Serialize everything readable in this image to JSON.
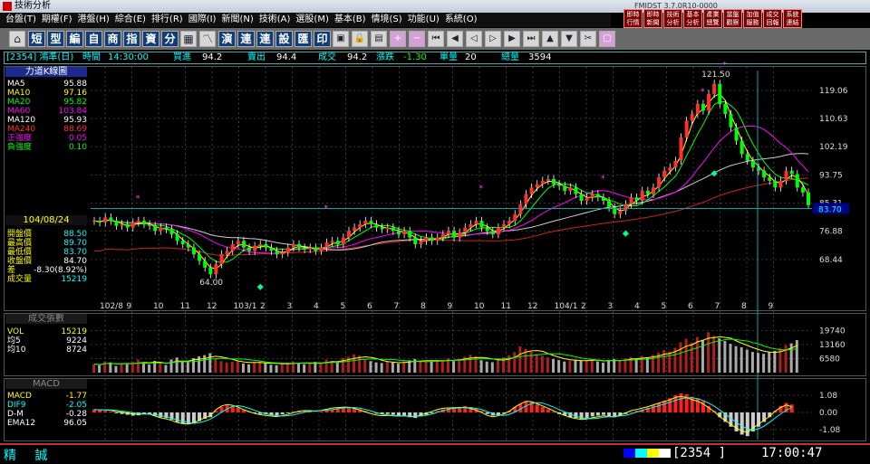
{
  "window": {
    "title": "技術分析",
    "version": "FMIDST 3.7.0R10-0000"
  },
  "menu": [
    "台盤(T)",
    "期權(F)",
    "港盤(H)",
    "綜合(E)",
    "排行(R)",
    "國際(I)",
    "新聞(N)",
    "技術(A)",
    "選股(M)",
    "基本(B)",
    "情境(S)",
    "功能(U)",
    "系統(O)"
  ],
  "right_buttons": [
    "即時行情",
    "即時新聞",
    "技術分析",
    "基本分析",
    "產業總覽",
    "當盤觀察",
    "加值服務",
    "成交回報",
    "系統連結"
  ],
  "toolbar": {
    "words": [
      "短",
      "型",
      "編",
      "自",
      "商",
      "指",
      "資",
      "分"
    ],
    "words2": [
      "演",
      "連",
      "連",
      "設",
      "匯",
      "印"
    ]
  },
  "infobar": {
    "code": "[2354] 鴻準(日)",
    "time_label": "時間",
    "time": "14:30:00",
    "buy_label": "買進",
    "buy": "94.2",
    "sell_label": "賣出",
    "sell": "94.4",
    "deal_label": "成交",
    "deal": "94.2",
    "change_label": "漲跌",
    "change": "-1.30",
    "unit_label": "單量",
    "unit": "20",
    "total_label": "總量",
    "total": "3594"
  },
  "price_panel": {
    "header": "力道K線圖",
    "indicators": [
      {
        "name": "MA5",
        "value": "95.88",
        "color": "#ffffff"
      },
      {
        "name": "MA10",
        "value": "97.16",
        "color": "#ffff00"
      },
      {
        "name": "MA20",
        "value": "95.82",
        "color": "#00ff00"
      },
      {
        "name": "MA60",
        "value": "103.84",
        "color": "#ff00ff"
      },
      {
        "name": "MA120",
        "value": "95.93",
        "color": "#ffffff"
      },
      {
        "name": "MA240",
        "value": "88.69",
        "color": "#ff3030"
      },
      {
        "name": "正強度",
        "value": "0.05",
        "color": "#ff00ff"
      },
      {
        "name": "負強度",
        "value": "0.10",
        "color": "#00ff00"
      }
    ],
    "date": "104/08/24",
    "ohlc": [
      {
        "name": "開盤價",
        "value": "88.50",
        "color": "#ffff00",
        "vcolor": "#00ffff"
      },
      {
        "name": "最高價",
        "value": "89.70",
        "color": "#ffff00",
        "vcolor": "#00ffff"
      },
      {
        "name": "最低價",
        "value": "83.70",
        "color": "#ffff00",
        "vcolor": "#00ffff"
      },
      {
        "name": "收盤價",
        "value": "84.70",
        "color": "#ffff00",
        "vcolor": "#ffffff"
      },
      {
        "name": "差",
        "value": "-8.30(8.92%)",
        "color": "#ffff00",
        "vcolor": "#ffffff"
      },
      {
        "name": "成交量",
        "value": "15219",
        "color": "#ffff00",
        "vcolor": "#00ffff"
      }
    ],
    "yticks": [
      "119.06",
      "110.63",
      "102.19",
      "93.75",
      "85.31",
      "76.88",
      "68.44"
    ],
    "cursor_price": "83.70",
    "high_label": "121.50",
    "low_label": "64.00",
    "xticks": [
      "102/8",
      "9",
      "10",
      "11",
      "12",
      "103/1",
      "2",
      "3",
      "4",
      "5",
      "6",
      "7",
      "8",
      "9",
      "10",
      "11",
      "12",
      "104/1",
      "2",
      "3",
      "4",
      "5",
      "6",
      "7",
      "8",
      "9"
    ]
  },
  "volume_panel": {
    "header": "成交張數",
    "indicators": [
      {
        "name": "VOL",
        "value": "15219",
        "color": "#ffff00"
      },
      {
        "name": "均5",
        "value": "9224",
        "color": "#ffffff"
      },
      {
        "name": "均10",
        "value": "8724",
        "color": "#ffffff"
      }
    ],
    "yticks": [
      "19740",
      "13160",
      "6580"
    ]
  },
  "macd_panel": {
    "header": "MACD",
    "indicators": [
      {
        "name": "MACD",
        "value": "-1.77",
        "color": "#ffff00"
      },
      {
        "name": "DIF9",
        "value": "-2.05",
        "color": "#00ffff"
      },
      {
        "name": "D-M",
        "value": "-0.28",
        "color": "#ffffff"
      },
      {
        "name": "EMA12",
        "value": "96.05",
        "color": "#ffffff"
      }
    ],
    "yticks": [
      "1.08",
      "0.00",
      "-1.08"
    ]
  },
  "status": {
    "brand": "精 誠",
    "code": "[2354  ]",
    "clock": "17:00:47"
  },
  "chart_data": {
    "type": "candlestick",
    "price_range": [
      60.0,
      125.0
    ],
    "volume_range": [
      0,
      22000
    ],
    "macd_range": [
      -1.6,
      1.6
    ],
    "closes": [
      80,
      79.5,
      81,
      80,
      78.5,
      79,
      78,
      79.5,
      80,
      79,
      78.5,
      77,
      78,
      77.5,
      76,
      74,
      73,
      72,
      70,
      68,
      66,
      64,
      67,
      70,
      71,
      73,
      74,
      72,
      71,
      72.5,
      73,
      72,
      71,
      70,
      70.5,
      72,
      73,
      72,
      71.5,
      72,
      71,
      72,
      73.5,
      74,
      73,
      75,
      77,
      78,
      79,
      80,
      79,
      78,
      77.5,
      78,
      77,
      76,
      77,
      75,
      73,
      74,
      75,
      74,
      75,
      76,
      77,
      75,
      76.5,
      78,
      79,
      80,
      78,
      77,
      76,
      78,
      79,
      80,
      82,
      85,
      88,
      90,
      91,
      92,
      92.5,
      91,
      90.5,
      89,
      90,
      88,
      86,
      87,
      88,
      87,
      86,
      84,
      82,
      83,
      85,
      87,
      86,
      89,
      88,
      90,
      93,
      95,
      96,
      98,
      105,
      110,
      112,
      115,
      113,
      118,
      121,
      115,
      112,
      108,
      104,
      100,
      98,
      96,
      95,
      93,
      92,
      90,
      92,
      95,
      94,
      90,
      88.5,
      84.7
    ],
    "volumes": [
      4000,
      3500,
      5200,
      4800,
      3100,
      4400,
      3900,
      5000,
      6100,
      4200,
      3800,
      5500,
      4700,
      3600,
      6200,
      7100,
      5300,
      4900,
      6800,
      7600,
      8200,
      9100,
      6500,
      5400,
      4800,
      5100,
      5600,
      4300,
      3900,
      4700,
      5200,
      4400,
      3700,
      3500,
      4100,
      4800,
      5200,
      4600,
      3900,
      4200,
      5000,
      4700,
      6100,
      5500,
      4800,
      6900,
      7400,
      8600,
      7900,
      6200,
      5400,
      4800,
      4500,
      5100,
      4700,
      4200,
      5300,
      5800,
      6400,
      5600,
      4900,
      5200,
      5800,
      6100,
      6700,
      5400,
      6200,
      7500,
      8300,
      7700,
      5800,
      5200,
      4900,
      6300,
      7200,
      8100,
      9600,
      12300,
      11200,
      9800,
      8700,
      7900,
      7100,
      6400,
      5900,
      5200,
      5600,
      6100,
      5500,
      5800,
      6200,
      5300,
      4700,
      5900,
      6400,
      5800,
      6600,
      7200,
      6500,
      7800,
      7100,
      8300,
      9400,
      10500,
      9800,
      11600,
      14200,
      15800,
      13900,
      16700,
      15300,
      18900,
      17200,
      16100,
      14800,
      13500,
      12400,
      11900,
      10800,
      9700,
      9200,
      8800,
      9500,
      10200,
      11600,
      12900,
      13700,
      15219
    ],
    "macd_hist": [
      0.2,
      0.15,
      0.1,
      0.05,
      -0.05,
      -0.1,
      -0.15,
      -0.2,
      -0.18,
      -0.12,
      -0.1,
      -0.2,
      -0.3,
      -0.35,
      -0.45,
      -0.6,
      -0.7,
      -0.75,
      -0.7,
      -0.55,
      -0.4,
      -0.3,
      0.1,
      0.35,
      0.45,
      0.4,
      0.3,
      0.15,
      0.05,
      -0.05,
      -0.1,
      -0.12,
      -0.15,
      -0.18,
      -0.12,
      -0.05,
      0.05,
      0.1,
      0.12,
      0.08,
      0.02,
      0.05,
      0.12,
      0.2,
      0.25,
      0.3,
      0.32,
      0.28,
      0.2,
      0.1,
      0.0,
      -0.08,
      -0.12,
      -0.1,
      -0.15,
      -0.2,
      -0.22,
      -0.3,
      -0.35,
      -0.25,
      -0.15,
      -0.05,
      0.1,
      0.2,
      0.25,
      0.3,
      0.35,
      0.4,
      0.35,
      0.25,
      0.1,
      -0.1,
      -0.2,
      -0.15,
      -0.05,
      0.1,
      0.35,
      0.55,
      0.7,
      0.65,
      0.5,
      0.35,
      0.2,
      0.05,
      -0.1,
      -0.2,
      -0.3,
      -0.35,
      -0.4,
      -0.35,
      -0.25,
      -0.2,
      -0.15,
      -0.25,
      -0.3,
      -0.2,
      -0.1,
      0.05,
      0.1,
      0.2,
      0.3,
      0.45,
      0.6,
      0.75,
      0.9,
      1.1,
      1.2,
      1.15,
      1.0,
      0.9,
      0.7,
      0.4,
      0.1,
      -0.3,
      -0.6,
      -0.9,
      -1.2,
      -1.4,
      -1.5,
      -1.2,
      -0.9,
      -0.6,
      -0.3,
      0.1,
      0.4,
      0.6,
      0.5
    ]
  }
}
